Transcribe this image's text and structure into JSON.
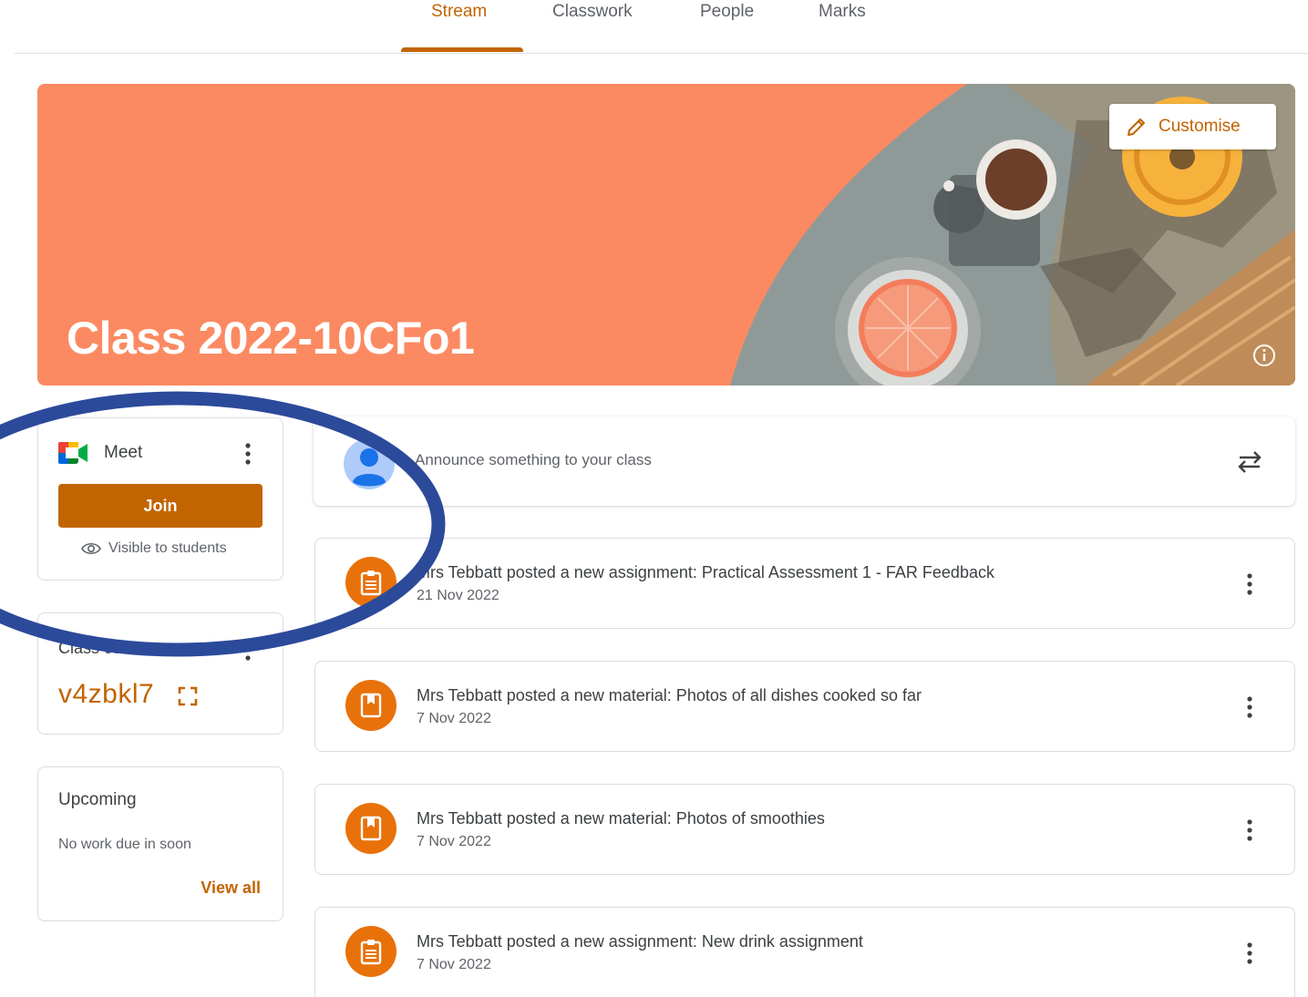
{
  "tabs": [
    {
      "label": "Stream",
      "active": true
    },
    {
      "label": "Classwork",
      "active": false
    },
    {
      "label": "People",
      "active": false
    },
    {
      "label": "Marks",
      "active": false
    }
  ],
  "banner": {
    "title": "Class 2022-10CFo1",
    "customise_label": "Customise",
    "background_color": "#fb8a62",
    "info_icon": "info-icon"
  },
  "meet": {
    "label": "Meet",
    "join_label": "Join",
    "visibility_text": "Visible to students",
    "accent_color": "#c26401"
  },
  "class_code": {
    "label": "Class code",
    "code": "v4zbkl7"
  },
  "upcoming": {
    "title": "Upcoming",
    "empty_text": "No work due in soon",
    "view_all_label": "View all"
  },
  "announce": {
    "placeholder": "Announce something to your class"
  },
  "posts": [
    {
      "type": "assignment",
      "icon": "assignment-icon",
      "title": "Mrs Tebbatt posted a new assignment: Practical Assessment 1 - FAR Feedback",
      "date": "21 Nov 2022"
    },
    {
      "type": "material",
      "icon": "material-icon",
      "title": "Mrs Tebbatt posted a new material: Photos of all dishes cooked so far",
      "date": "7 Nov 2022"
    },
    {
      "type": "material",
      "icon": "material-icon",
      "title": "Mrs Tebbatt posted a new material: Photos of smoothies",
      "date": "7 Nov 2022"
    },
    {
      "type": "assignment",
      "icon": "assignment-icon",
      "title": "Mrs Tebbatt posted a new assignment: New drink assignment",
      "date": "7 Nov 2022"
    }
  ],
  "annotation": {
    "color": "#2c4a9a",
    "shape": "ellipse"
  }
}
